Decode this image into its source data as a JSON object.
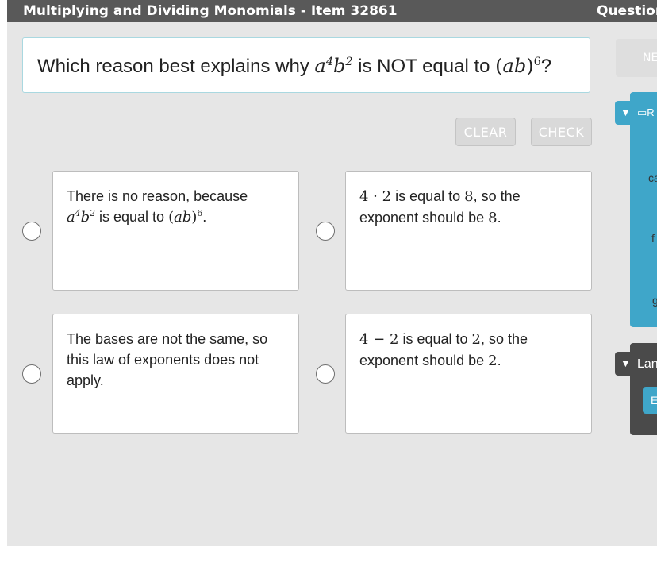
{
  "header": {
    "title": "Multiplying and Dividing Monomials - Item 32861",
    "question_label": "Question"
  },
  "prompt": {
    "before": "Which reason best explains why ",
    "middle": " is NOT equal to ",
    "after": "?"
  },
  "buttons": {
    "clear": "CLEAR",
    "check": "CHECK",
    "next": "NE"
  },
  "choices": [
    {
      "line1": "There is no reason, because",
      "is_equal_to": " is equal to ",
      "period": "."
    },
    {
      "op": "4 · 2",
      "mid": " is equal to ",
      "result": "8",
      "tail": ", so the",
      "line2": "exponent should be ",
      "exp": "8",
      "period": "."
    },
    {
      "text": "The bases are not the same, so this law of exponents does not apply."
    },
    {
      "op": "4 − 2",
      "mid": " is equal to ",
      "result": "2",
      "tail": ", so the",
      "line2": "exponent should be ",
      "exp": "2",
      "period": "."
    }
  ],
  "side_panel": {
    "resources_label": "R",
    "letters": [
      "ca",
      "f",
      "g"
    ],
    "language_label": "Lan",
    "language_button": "E"
  },
  "colors": {
    "header_bg": "#595959",
    "panel_blue": "#3fa6c9",
    "panel_dark": "#4a4a4a",
    "workspace_bg": "#e6e6e6"
  }
}
